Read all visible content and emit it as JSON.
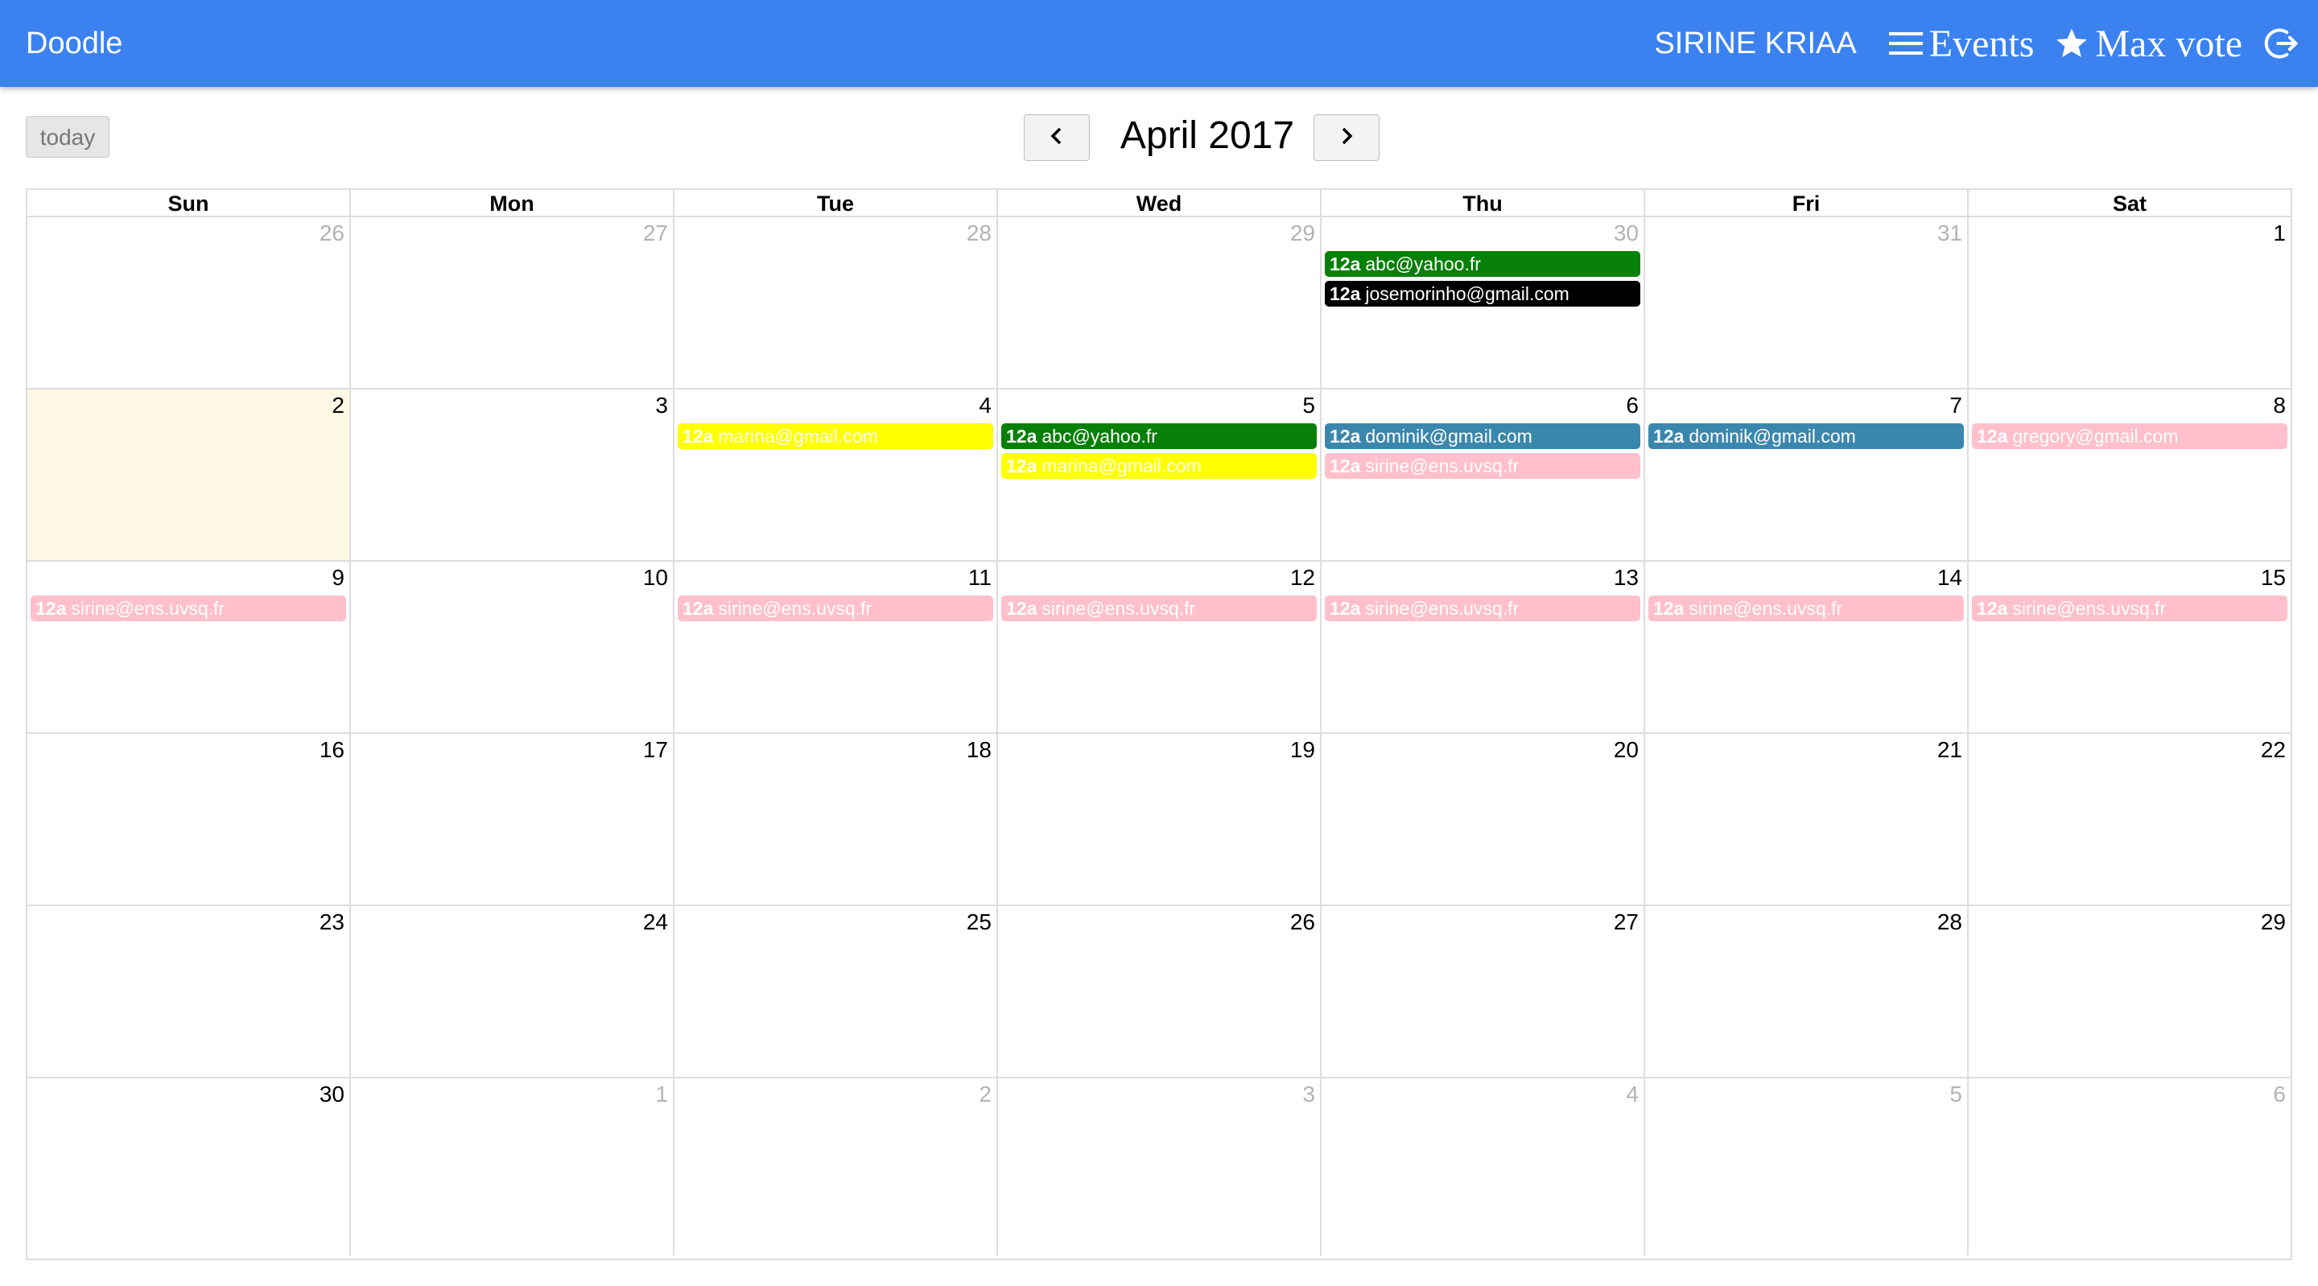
{
  "header": {
    "brand": "Doodle",
    "user": "SIRINE KRIAA",
    "events_label": "Events",
    "max_vote_label": "Max vote"
  },
  "toolbar": {
    "today_label": "today",
    "title": "April 2017"
  },
  "colors": {
    "navbar": "#3b82f0",
    "today_highlight": "#fcf8e3",
    "green": "#068006",
    "black": "#000000",
    "yellow": "#ffff00",
    "steelblue": "#3a87ad",
    "pink": "#ffc0cb"
  },
  "weekdays": [
    "Sun",
    "Mon",
    "Tue",
    "Wed",
    "Thu",
    "Fri",
    "Sat"
  ],
  "weeks": [
    [
      {
        "day": "26",
        "other": true,
        "events": []
      },
      {
        "day": "27",
        "other": true,
        "events": []
      },
      {
        "day": "28",
        "other": true,
        "events": []
      },
      {
        "day": "29",
        "other": true,
        "events": []
      },
      {
        "day": "30",
        "other": true,
        "events": [
          {
            "time": "12a",
            "title": "abc@yahoo.fr",
            "bg": "#068006",
            "fg": "#ffffff"
          },
          {
            "time": "12a",
            "title": "josemorinho@gmail.com",
            "bg": "#000000",
            "fg": "#ffffff"
          }
        ]
      },
      {
        "day": "31",
        "other": true,
        "events": []
      },
      {
        "day": "1",
        "other": false,
        "events": []
      }
    ],
    [
      {
        "day": "2",
        "other": false,
        "today": true,
        "events": []
      },
      {
        "day": "3",
        "other": false,
        "events": []
      },
      {
        "day": "4",
        "other": false,
        "events": [
          {
            "time": "12a",
            "title": "marina@gmail.com",
            "bg": "#ffff00",
            "fg": "#ffffff"
          }
        ]
      },
      {
        "day": "5",
        "other": false,
        "events": [
          {
            "time": "12a",
            "title": "abc@yahoo.fr",
            "bg": "#068006",
            "fg": "#ffffff"
          },
          {
            "time": "12a",
            "title": "marina@gmail.com",
            "bg": "#ffff00",
            "fg": "#ffffff"
          }
        ]
      },
      {
        "day": "6",
        "other": false,
        "events": [
          {
            "time": "12a",
            "title": "dominik@gmail.com",
            "bg": "#3a87ad",
            "fg": "#ffffff"
          },
          {
            "time": "12a",
            "title": "sirine@ens.uvsq.fr",
            "bg": "#ffc0cb",
            "fg": "#ffffff"
          }
        ]
      },
      {
        "day": "7",
        "other": false,
        "events": [
          {
            "time": "12a",
            "title": "dominik@gmail.com",
            "bg": "#3a87ad",
            "fg": "#ffffff"
          }
        ]
      },
      {
        "day": "8",
        "other": false,
        "events": [
          {
            "time": "12a",
            "title": "gregory@gmail.com",
            "bg": "#ffc0cb",
            "fg": "#ffffff"
          }
        ]
      }
    ],
    [
      {
        "day": "9",
        "other": false,
        "events": [
          {
            "time": "12a",
            "title": "sirine@ens.uvsq.fr",
            "bg": "#ffc0cb",
            "fg": "#ffffff"
          }
        ]
      },
      {
        "day": "10",
        "other": false,
        "events": []
      },
      {
        "day": "11",
        "other": false,
        "events": [
          {
            "time": "12a",
            "title": "sirine@ens.uvsq.fr",
            "bg": "#ffc0cb",
            "fg": "#ffffff"
          }
        ]
      },
      {
        "day": "12",
        "other": false,
        "events": [
          {
            "time": "12a",
            "title": "sirine@ens.uvsq.fr",
            "bg": "#ffc0cb",
            "fg": "#ffffff"
          }
        ]
      },
      {
        "day": "13",
        "other": false,
        "events": [
          {
            "time": "12a",
            "title": "sirine@ens.uvsq.fr",
            "bg": "#ffc0cb",
            "fg": "#ffffff"
          }
        ]
      },
      {
        "day": "14",
        "other": false,
        "events": [
          {
            "time": "12a",
            "title": "sirine@ens.uvsq.fr",
            "bg": "#ffc0cb",
            "fg": "#ffffff"
          }
        ]
      },
      {
        "day": "15",
        "other": false,
        "events": [
          {
            "time": "12a",
            "title": "sirine@ens.uvsq.fr",
            "bg": "#ffc0cb",
            "fg": "#ffffff"
          }
        ]
      }
    ],
    [
      {
        "day": "16",
        "other": false,
        "events": []
      },
      {
        "day": "17",
        "other": false,
        "events": []
      },
      {
        "day": "18",
        "other": false,
        "events": []
      },
      {
        "day": "19",
        "other": false,
        "events": []
      },
      {
        "day": "20",
        "other": false,
        "events": []
      },
      {
        "day": "21",
        "other": false,
        "events": []
      },
      {
        "day": "22",
        "other": false,
        "events": []
      }
    ],
    [
      {
        "day": "23",
        "other": false,
        "events": []
      },
      {
        "day": "24",
        "other": false,
        "events": []
      },
      {
        "day": "25",
        "other": false,
        "events": []
      },
      {
        "day": "26",
        "other": false,
        "events": []
      },
      {
        "day": "27",
        "other": false,
        "events": []
      },
      {
        "day": "28",
        "other": false,
        "events": []
      },
      {
        "day": "29",
        "other": false,
        "events": []
      }
    ],
    [
      {
        "day": "30",
        "other": false,
        "events": []
      },
      {
        "day": "1",
        "other": true,
        "events": []
      },
      {
        "day": "2",
        "other": true,
        "events": []
      },
      {
        "day": "3",
        "other": true,
        "events": []
      },
      {
        "day": "4",
        "other": true,
        "events": []
      },
      {
        "day": "5",
        "other": true,
        "events": []
      },
      {
        "day": "6",
        "other": true,
        "events": []
      }
    ]
  ]
}
